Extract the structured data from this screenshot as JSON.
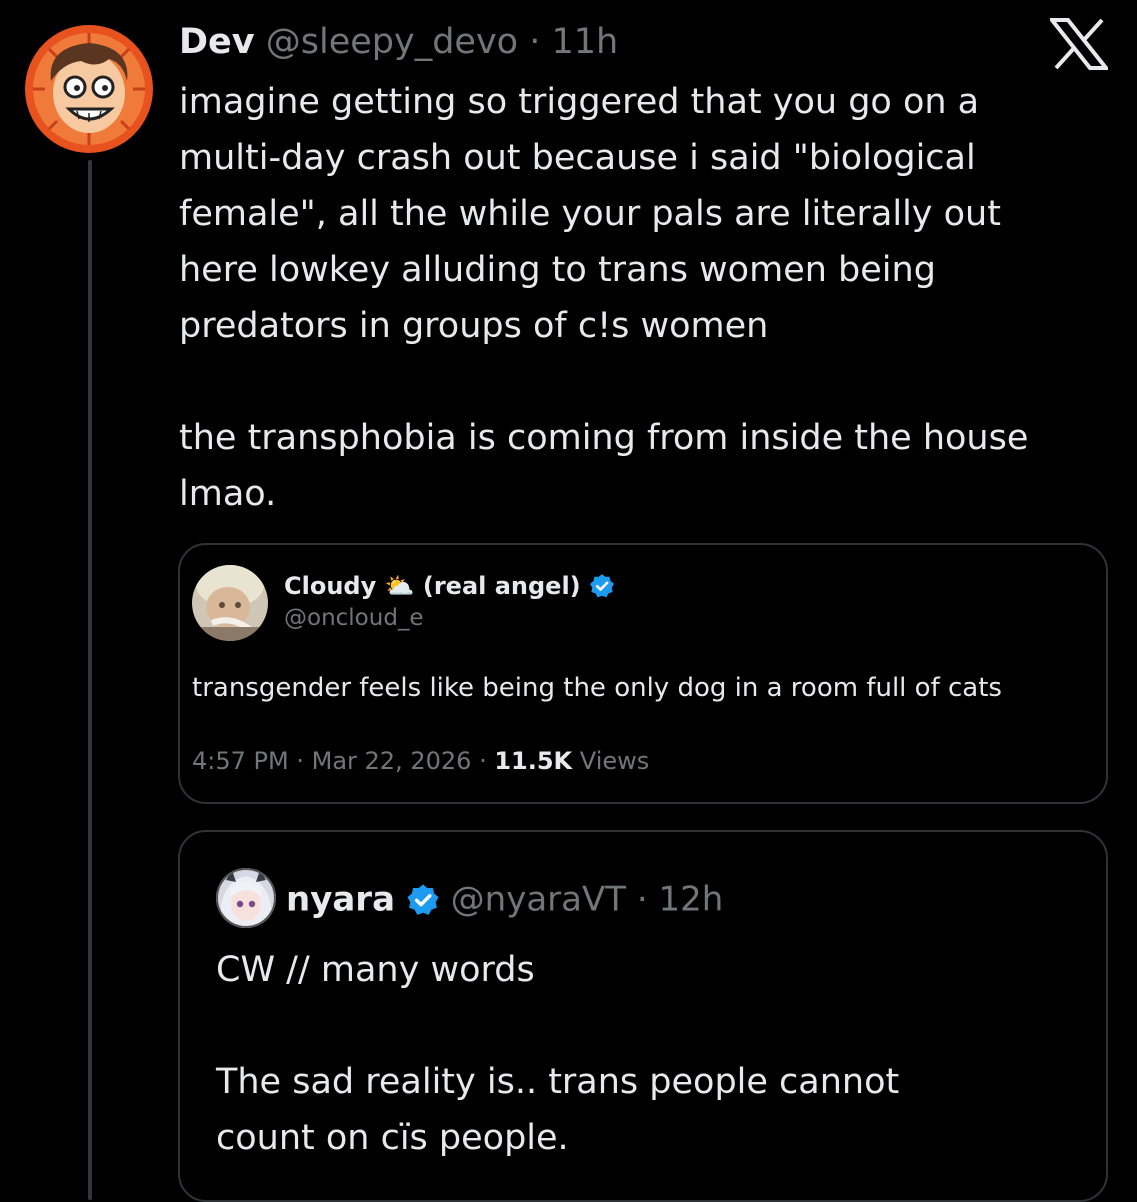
{
  "main_tweet": {
    "display_name": "Dev",
    "handle": "@sleepy_devo",
    "separator": "·",
    "time_ago": "11h",
    "text": "imagine getting so triggered that you go on a\nmulti-day crash out because i said \"biological\nfemale\", all the while your pals are literally out\nhere lowkey alluding to trans women being\npredators in groups of c!s women\n\nthe transphobia is coming from inside the house\nlmao.",
    "avatar_icon": "cartoon-face-avatar",
    "platform_icon": "x-logo-icon"
  },
  "quoted_tweet_1": {
    "display_name": "Cloudy",
    "name_emoji": "⛅",
    "name_suffix": "(real angel)",
    "handle": "@oncloud_e",
    "verified": true,
    "text": "transgender feels like being the only dog in a room full of cats",
    "time": "4:57 PM",
    "date": "Mar 22, 2026",
    "separator": "·",
    "views_count": "11.5K",
    "views_label": "Views"
  },
  "quoted_tweet_2": {
    "display_name": "nyara",
    "handle": "@nyaraVT",
    "separator": "·",
    "time_ago": "12h",
    "verified": true,
    "text": "CW // many words\n\nThe sad reality is.. trans people cannot\ncount on cïs people."
  },
  "colors": {
    "background": "#000000",
    "text_primary": "#e7e9ea",
    "text_secondary": "#71767b",
    "border": "#2f3336",
    "verified_blue": "#1d9bf0",
    "avatar_orange": "#e8521f"
  }
}
